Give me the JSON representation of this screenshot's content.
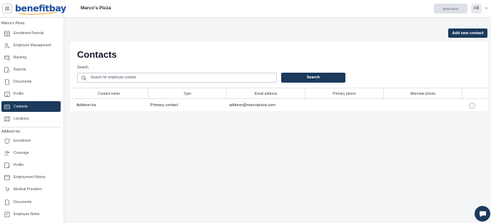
{
  "header": {
    "logo_text": "benefitbay",
    "company_name": "Marco's Pizza",
    "env_button": "Demo Env",
    "avatar_initials": "AB"
  },
  "sidebar": {
    "company_section": "Marco's Pizza",
    "company_items": [
      {
        "label": "Enrollment Periods",
        "icon": "calendar-grid-icon"
      },
      {
        "label": "Employee Management",
        "icon": "user-gear-icon"
      },
      {
        "label": "Banking",
        "icon": "bank-card-icon"
      },
      {
        "label": "Reports",
        "icon": "gear-report-icon"
      },
      {
        "label": "Documents",
        "icon": "document-icon"
      },
      {
        "label": "Profile",
        "icon": "building-icon"
      },
      {
        "label": "Contacts",
        "icon": "contacts-card-icon",
        "active": true
      },
      {
        "label": "Locations",
        "icon": "map-icon"
      }
    ],
    "employee_section": "Addison ba",
    "employee_items": [
      {
        "label": "Enrollment",
        "icon": "shield-icon"
      },
      {
        "label": "Coverage",
        "icon": "users-icon"
      },
      {
        "label": "Profile",
        "icon": "profile-edit-icon"
      },
      {
        "label": "Employment History",
        "icon": "history-icon"
      },
      {
        "label": "Medical Providers",
        "icon": "medical-icon"
      },
      {
        "label": "Documents",
        "icon": "document-icon"
      },
      {
        "label": "Employee Notes",
        "icon": "note-icon"
      }
    ]
  },
  "main": {
    "add_button": "Add new contact",
    "title": "Contacts",
    "search_label": "Search",
    "search_placeholder": "Search for employee contact",
    "search_button": "Search",
    "table": {
      "columns": [
        "Contact name",
        "Type",
        "Email address",
        "Primary phone",
        "Alternate phone"
      ],
      "rows": [
        {
          "name": "Addison ba",
          "type": "Primary contact",
          "email": "addison@marcopizza.com",
          "primary_phone": "",
          "alternate_phone": ""
        }
      ]
    },
    "row_menu_label": "···"
  },
  "colors": {
    "brand_navy": "#1b3a5c",
    "logo_blue": "#1c4f9c",
    "background": "#f4f5f7"
  }
}
